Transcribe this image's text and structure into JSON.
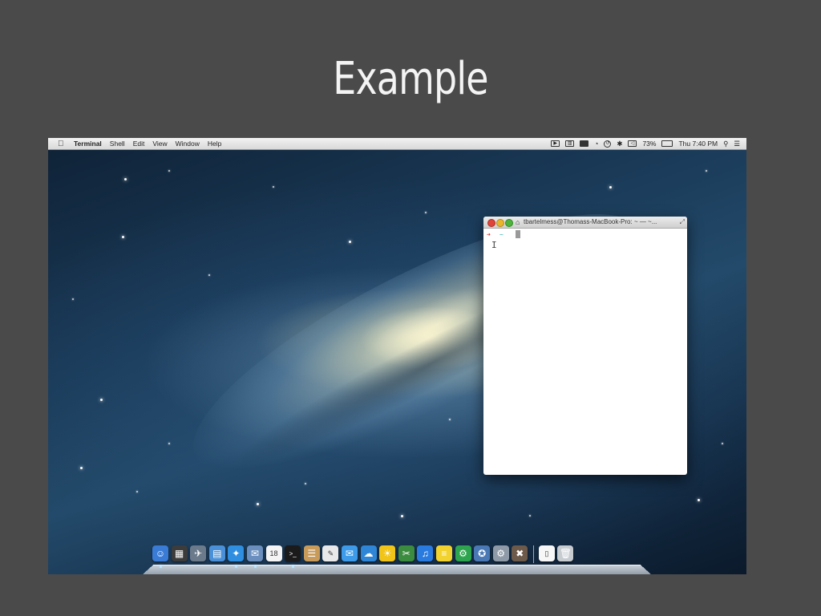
{
  "slide": {
    "title": "Example"
  },
  "menubar": {
    "app_name": "Terminal",
    "items": [
      "Shell",
      "Edit",
      "View",
      "Window",
      "Help"
    ],
    "status": {
      "battery": "73%",
      "clock": "Thu 7:40 PM",
      "icons": [
        "screen-record-icon",
        "mirror-icon",
        "keyboard-icon",
        "wifi-icon",
        "time-machine-icon",
        "bluetooth-icon",
        "volume-icon",
        "battery-icon",
        "spotlight-icon",
        "notification-center-icon"
      ]
    }
  },
  "terminal": {
    "title": "tbartelmess@Thomass-MacBook-Pro: ~ — ~...",
    "prompt_arrow": "➜",
    "prompt_dir": "~"
  },
  "dock": {
    "apps": [
      {
        "name": "finder",
        "color": "#3a7bd5",
        "glyph": "☺"
      },
      {
        "name": "dashboard",
        "color": "#3c3c3c",
        "glyph": "▦"
      },
      {
        "name": "launchpad",
        "color": "#6b7b8c",
        "glyph": "✈"
      },
      {
        "name": "mission-control",
        "color": "#4a90d9",
        "glyph": "▤"
      },
      {
        "name": "safari",
        "color": "#2f8ee0",
        "glyph": "✦"
      },
      {
        "name": "mail",
        "color": "#6a8fbf",
        "glyph": "✉"
      },
      {
        "name": "calendar",
        "color": "#f5f5f5",
        "glyph": "18"
      },
      {
        "name": "terminal",
        "color": "#1b1b1b",
        "glyph": ">_"
      },
      {
        "name": "contacts",
        "color": "#c89b5a",
        "glyph": "☰"
      },
      {
        "name": "textedit",
        "color": "#e9e9e9",
        "glyph": "✎"
      },
      {
        "name": "messages",
        "color": "#3d9be9",
        "glyph": "✉"
      },
      {
        "name": "ichat",
        "color": "#2f86d6",
        "glyph": "☁"
      },
      {
        "name": "sunrise-app",
        "color": "#f0c419",
        "glyph": "☀"
      },
      {
        "name": "xcode-instruments",
        "color": "#3b8c3e",
        "glyph": "✂"
      },
      {
        "name": "itunes",
        "color": "#2a7be0",
        "glyph": "♫"
      },
      {
        "name": "stickies",
        "color": "#f2d22e",
        "glyph": "≡"
      },
      {
        "name": "github",
        "color": "#2ea44f",
        "glyph": "⚙"
      },
      {
        "name": "tweetbot",
        "color": "#4a78b5",
        "glyph": "✪"
      },
      {
        "name": "system-preferences",
        "color": "#8e9aa8",
        "glyph": "⚙"
      },
      {
        "name": "utility",
        "color": "#6d5a4a",
        "glyph": "✖"
      }
    ],
    "stacks": [
      {
        "name": "documents",
        "color": "#f7f7f7",
        "glyph": "▯"
      },
      {
        "name": "trash",
        "color": "#c7ccd1",
        "glyph": "🗑"
      }
    ]
  }
}
